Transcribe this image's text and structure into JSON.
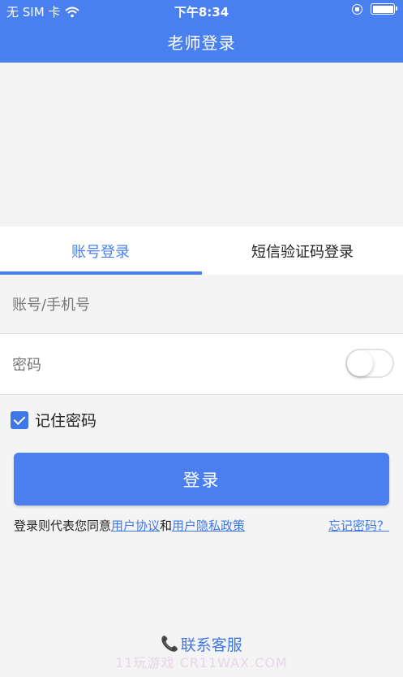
{
  "status_bar": {
    "carrier": "无 SIM 卡",
    "time": "下午8:34",
    "wifi_icon": "wifi-icon",
    "battery_icon": "battery-icon"
  },
  "header": {
    "title": "老师登录"
  },
  "tabs": [
    {
      "label": "账号登录",
      "active": true
    },
    {
      "label": "短信验证码登录",
      "active": false
    }
  ],
  "form": {
    "account_placeholder": "账号/手机号",
    "password_placeholder": "密码",
    "remember_label": "记住密码",
    "remember_checked": true,
    "login_label": "登录"
  },
  "agreement": {
    "prefix": "登录则代表您同意",
    "user_agreement": "用户协议",
    "and": "和",
    "privacy_policy": "用户隐私政策",
    "forgot_password": "忘记密码？"
  },
  "contact": {
    "label": "联系客服"
  },
  "watermark": "11玩游戏 CR11WAX.COM",
  "colors": {
    "primary": "#4a7ff0",
    "background": "#f4f4f4"
  }
}
